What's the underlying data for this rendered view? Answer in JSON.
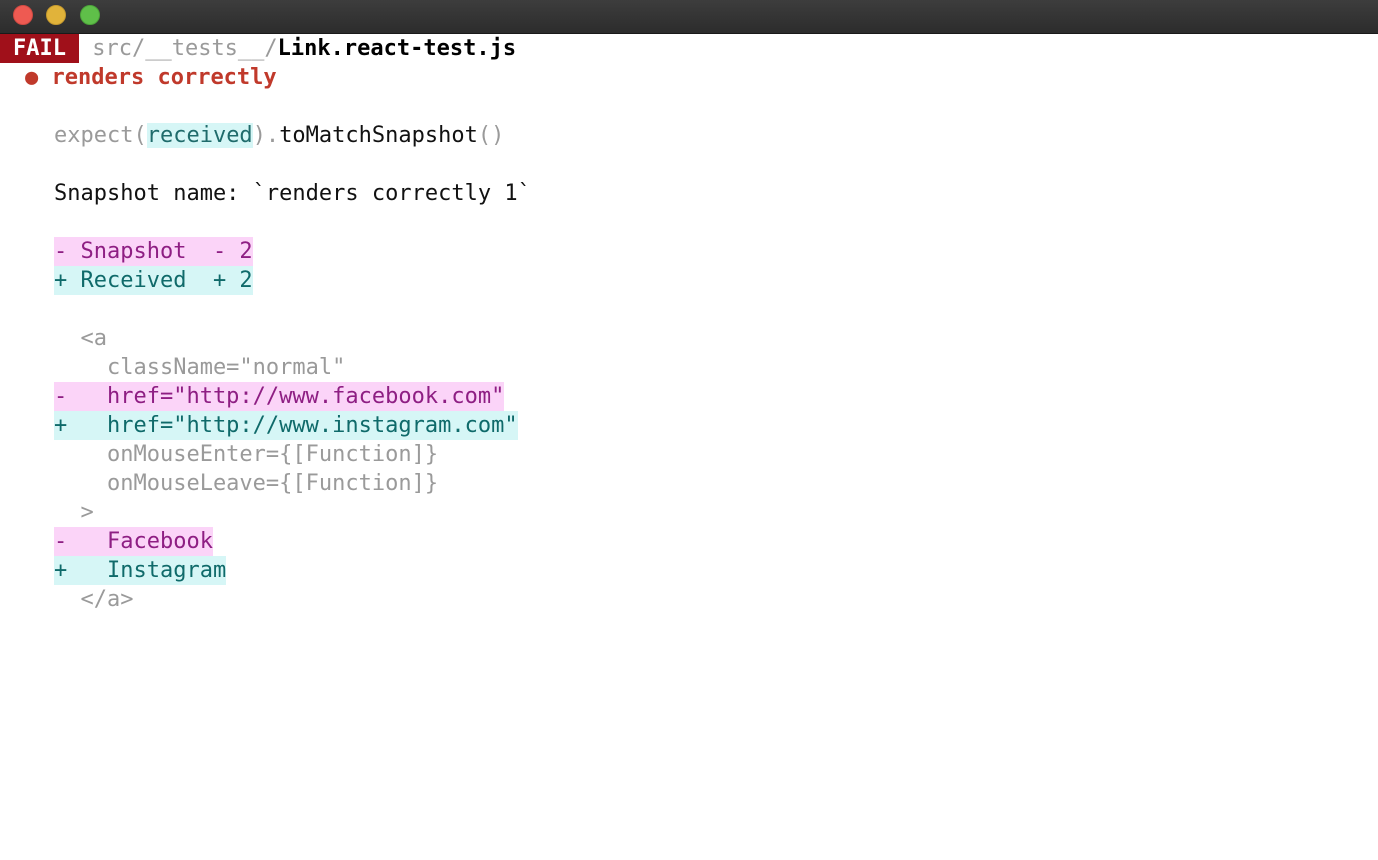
{
  "window": {
    "buttons": [
      "close",
      "minimize",
      "zoom"
    ]
  },
  "header": {
    "status": "FAIL",
    "path_dim": "src/__tests__/",
    "path_file": "Link.react-test.js"
  },
  "test": {
    "bullet": "●",
    "name": "renders correctly"
  },
  "expect": {
    "prefix": "expect(",
    "received": "received",
    "middle": ").",
    "matcher": "toMatchSnapshot",
    "suffix": "()"
  },
  "snapshot_name": "Snapshot name: `renders correctly 1`",
  "legend": {
    "snapshot": "- Snapshot  - 2",
    "received": "+ Received  + 2"
  },
  "diff": [
    {
      "kind": "context",
      "text": "  <a"
    },
    {
      "kind": "context",
      "text": "    className=\"normal\""
    },
    {
      "kind": "removed",
      "text": "-   href=\"http://www.facebook.com\""
    },
    {
      "kind": "added",
      "text": "+   href=\"http://www.instagram.com\""
    },
    {
      "kind": "context",
      "text": "    onMouseEnter={[Function]}"
    },
    {
      "kind": "context",
      "text": "    onMouseLeave={[Function]}"
    },
    {
      "kind": "context",
      "text": "  >"
    },
    {
      "kind": "removed",
      "text": "-   Facebook"
    },
    {
      "kind": "added",
      "text": "+   Instagram"
    },
    {
      "kind": "context",
      "text": "  </a>"
    }
  ],
  "colors": {
    "fail_badge": "#a0101a",
    "snapshot_bg": "#fbd4f8",
    "snapshot_fg": "#8e1e83",
    "received_bg": "#d6f6f6",
    "received_fg": "#0f6a6a",
    "error_red": "#c0392b"
  }
}
